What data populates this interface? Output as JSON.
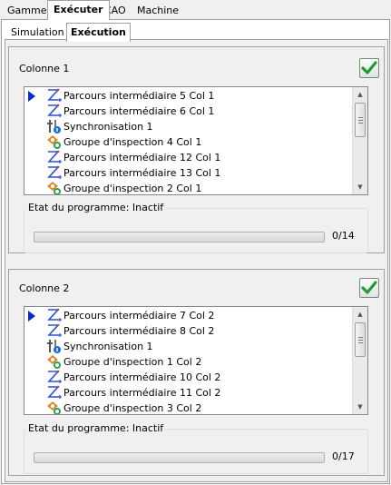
{
  "top_tabs": [
    {
      "label": "Gamme",
      "active": false
    },
    {
      "label": "Exécuter",
      "active": true
    },
    {
      "label": "CAO",
      "active": false
    },
    {
      "label": "Machine",
      "active": false
    }
  ],
  "sub_tabs": [
    {
      "label": "Simulation",
      "active": false
    },
    {
      "label": "Exécution",
      "active": true
    }
  ],
  "colors": {
    "check_green": "#1e9e2e",
    "marker_blue": "#0a2ad4",
    "path_blue": "#2a52d6",
    "path_red": "#d93a2a",
    "sync_blue": "#1c6ee0",
    "inspect_orange": "#e08a2a",
    "inspect_green": "#29a34a"
  },
  "columns": [
    {
      "title": "Colonne 1",
      "check_icon": "green-check-icon",
      "items": [
        {
          "icon": "path-icon",
          "label": "Parcours intermédiaire 5 Col 1",
          "current": true
        },
        {
          "icon": "path-icon",
          "label": "Parcours intermédiaire 6 Col 1",
          "current": false
        },
        {
          "icon": "sync-icon",
          "label": "Synchronisation 1",
          "current": false
        },
        {
          "icon": "inspection-icon",
          "label": "Groupe d'inspection 4 Col 1",
          "current": false
        },
        {
          "icon": "path-icon",
          "label": "Parcours intermédiaire 12 Col 1",
          "current": false
        },
        {
          "icon": "path-icon",
          "label": "Parcours intermédiaire 13 Col 1",
          "current": false
        },
        {
          "icon": "inspection-icon",
          "label": "Groupe d'inspection 2 Col 1",
          "current": false
        }
      ],
      "state_label": "Etat du programme: Inactif",
      "progress_text": "0/14",
      "progress_value": 0
    },
    {
      "title": "Colonne 2",
      "check_icon": "green-check-icon",
      "items": [
        {
          "icon": "path-icon",
          "label": "Parcours intermédiaire 7 Col 2",
          "current": true
        },
        {
          "icon": "path-icon",
          "label": "Parcours intermédiaire 8 Col 2",
          "current": false
        },
        {
          "icon": "sync-icon",
          "label": "Synchronisation 1",
          "current": false
        },
        {
          "icon": "inspection-icon",
          "label": "Groupe d'inspection 1 Col 2",
          "current": false
        },
        {
          "icon": "path-icon",
          "label": "Parcours intermédiaire 10 Col 2",
          "current": false
        },
        {
          "icon": "path-icon",
          "label": "Parcours intermédiaire 11 Col 2",
          "current": false
        },
        {
          "icon": "inspection-icon",
          "label": "Groupe d'inspection 3 Col 2",
          "current": false
        }
      ],
      "state_label": "Etat du programme: Inactif",
      "progress_text": "0/17",
      "progress_value": 0
    }
  ]
}
